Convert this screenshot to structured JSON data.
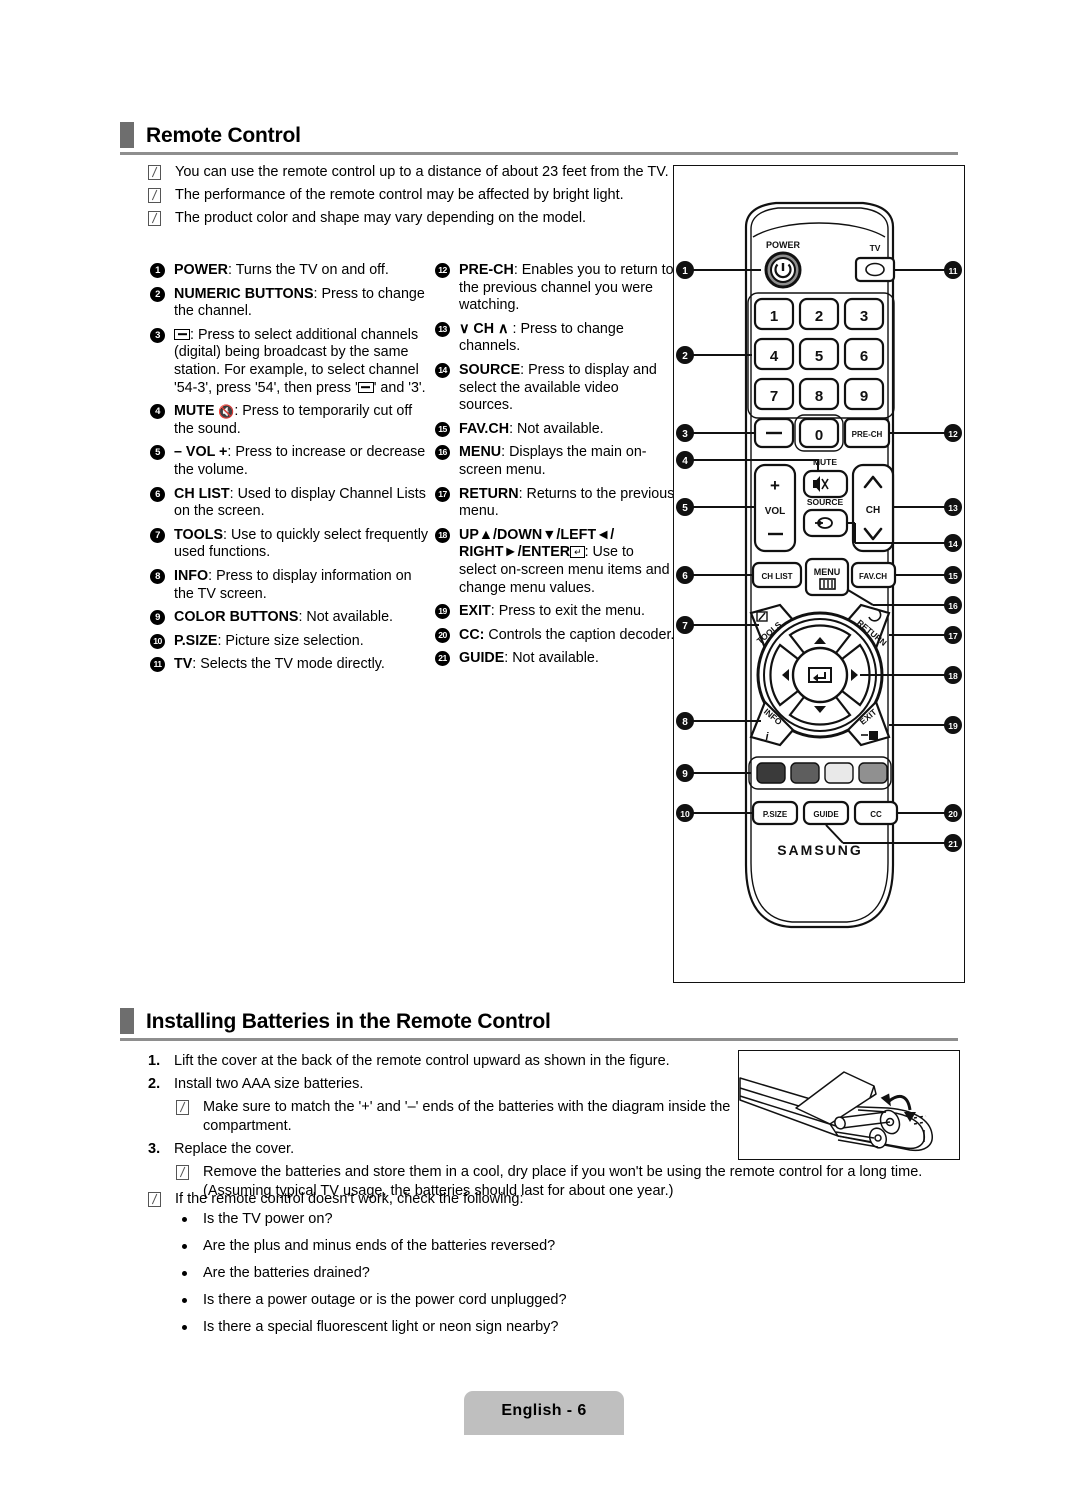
{
  "sections": {
    "remote_control": {
      "title": "Remote Control",
      "notes": [
        "You can use the remote control up to a distance of about 23 feet from the TV.",
        "The performance of the remote control may be affected by bright light.",
        "The product color and shape may vary depending on the model."
      ]
    },
    "installing_batteries": {
      "title": "Installing Batteries in the Remote Control",
      "steps": [
        {
          "num": "1.",
          "text": "Lift the cover at the back of the remote control upward as shown in the figure."
        },
        {
          "num": "2.",
          "text": "Install two AAA size batteries."
        },
        {
          "num": "3.",
          "text": "Replace the cover."
        }
      ],
      "step2_note": "Make sure to match the '+' and '–' ends of the batteries with the diagram inside the compartment.",
      "step3_note": "Remove the batteries and store them in a cool, dry place if you won't be using the remote control for a long time. (Assuming typical TV usage, the batteries should last for about one year.)",
      "check_note": "If the remote control doesn't work, check the following:",
      "checklist": [
        "Is the TV power on?",
        "Are the plus and minus ends of the batteries reversed?",
        "Are the batteries drained?",
        "Is there a power outage  or is the power cord unplugged?",
        "Is there a special fluorescent light or neon sign nearby?"
      ]
    }
  },
  "callouts_left": [
    {
      "n": "1",
      "label": "POWER",
      "sep": ": ",
      "desc": "Turns the TV on and off."
    },
    {
      "n": "2",
      "label": "NUMERIC BUTTONS",
      "sep": ": ",
      "desc": "Press to change the channel."
    },
    {
      "n": "3",
      "label": "",
      "sep": "",
      "desc": ": Press to select additional channels (digital) being broadcast by the same station. For example, to select channel '54-3', press '54', then press '",
      "desc_tail": "' and '3'.",
      "glyph": "dash-box"
    },
    {
      "n": "4",
      "label": "MUTE",
      "sep": "",
      "desc": ": Press to temporarily cut off the sound.",
      "glyph": "mute"
    },
    {
      "n": "5",
      "label": "– VOL +",
      "sep": "",
      "desc": ": Press to increase or decrease the volume."
    },
    {
      "n": "6",
      "label": "CH LIST",
      "sep": ": ",
      "desc": "Used to display Channel Lists on the screen."
    },
    {
      "n": "7",
      "label": "TOOLS",
      "sep": ": ",
      "desc": "Use to quickly select frequently used functions."
    },
    {
      "n": "8",
      "label": "INFO",
      "sep": ": ",
      "desc": "Press to display information on the TV screen."
    },
    {
      "n": "9",
      "label": "COLOR BUTTONS",
      "sep": ": ",
      "desc": "Not available."
    },
    {
      "n": "10",
      "label": "P.SIZE",
      "sep": ": ",
      "desc": "Picture size selection."
    },
    {
      "n": "11",
      "label": "TV",
      "sep": ": ",
      "desc": "Selects the TV mode directly."
    }
  ],
  "callouts_right": [
    {
      "n": "12",
      "label": "PRE-CH",
      "sep": ": ",
      "desc": "Enables you to return to the previous channel you were watching."
    },
    {
      "n": "13",
      "label": "∨ CH ∧",
      "sep": "",
      "desc": " : Press to change channels."
    },
    {
      "n": "14",
      "label": "SOURCE",
      "sep": ": ",
      "desc": "Press to display and select the available video sources."
    },
    {
      "n": "15",
      "label": "FAV.CH",
      "sep": ": ",
      "desc": "Not available."
    },
    {
      "n": "16",
      "label": "MENU",
      "sep": ": ",
      "desc": "Displays the main on-screen menu."
    },
    {
      "n": "17",
      "label": "RETURN",
      "sep": ": ",
      "desc": "Returns to the previous menu."
    },
    {
      "n": "18",
      "label": "UP▲/DOWN▼/LEFT◄/ RIGHT►/ENTER",
      "sep": "",
      "desc": ": Use to select on-screen menu items and change menu values.",
      "glyph": "enter"
    },
    {
      "n": "19",
      "label": "EXIT",
      "sep": ": ",
      "desc": "Press to exit the menu."
    },
    {
      "n": "20",
      "label": "CC:",
      "sep": " ",
      "desc": "Controls the caption decoder."
    },
    {
      "n": "21",
      "label": "GUIDE",
      "sep": ": ",
      "desc": "Not available."
    }
  ],
  "remote": {
    "brand": "SAMSUNG",
    "labels": {
      "power": "POWER",
      "tv": "TV",
      "prech": "PRE-CH",
      "mute": "MUTE",
      "source": "SOURCE",
      "vol": "VOL",
      "ch": "CH",
      "chlist": "CH LIST",
      "menu": "MENU",
      "favch": "FAV.CH",
      "tools": "TOOLS",
      "return": "RETURN",
      "info": "INFO",
      "exit": "EXIT",
      "psize": "P.SIZE",
      "guide": "GUIDE",
      "cc": "CC",
      "minus": "–",
      "plus": "+"
    },
    "keypad": [
      "1",
      "2",
      "3",
      "4",
      "5",
      "6",
      "7",
      "8",
      "9"
    ],
    "zero": "0",
    "callout_numbers_left": [
      "1",
      "2",
      "3",
      "4",
      "5",
      "6",
      "7",
      "8",
      "9",
      "10"
    ],
    "callout_numbers_right": [
      "11",
      "12",
      "13",
      "14",
      "15",
      "16",
      "17",
      "18",
      "19",
      "20",
      "21"
    ],
    "color_buttons": [
      "#3a3a3a",
      "#5e5e5e",
      "#e9e9e9",
      "#909090"
    ]
  },
  "footer": {
    "page_label": "English - 6"
  },
  "colors": {
    "heading_marker": "#6e6e6e",
    "heading_rule": "#8e8e8e",
    "footer_bg": "#bfbfbf",
    "ink": "#000000"
  }
}
